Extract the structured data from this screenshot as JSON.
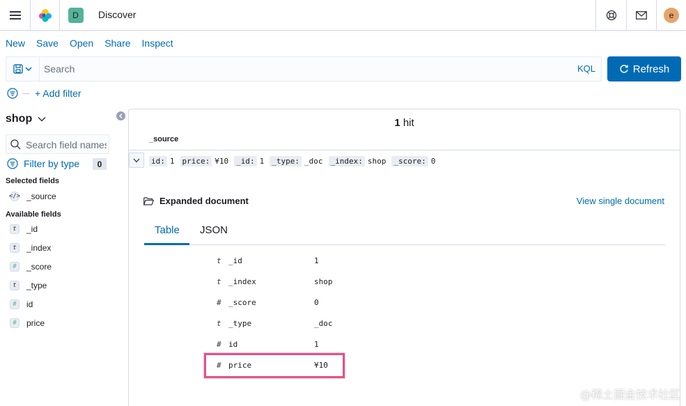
{
  "header": {
    "space_initial": "D",
    "app_title": "Discover",
    "user_initial": "e"
  },
  "topnav": {
    "items": [
      "New",
      "Save",
      "Open",
      "Share",
      "Inspect"
    ]
  },
  "querybar": {
    "placeholder": "Search",
    "language": "KQL",
    "refresh_label": "Refresh"
  },
  "filters": {
    "add_label": "+ Add filter"
  },
  "sidebar": {
    "index_pattern": "shop",
    "search_placeholder": "Search field names",
    "filter_by_type": "Filter by type",
    "filter_count": "0",
    "selected_title": "Selected fields",
    "selected_fields": [
      {
        "name": "_source",
        "type": "source"
      }
    ],
    "available_title": "Available fields",
    "available_fields": [
      {
        "name": "_id",
        "type": "t"
      },
      {
        "name": "_index",
        "type": "t"
      },
      {
        "name": "_score",
        "type": "#"
      },
      {
        "name": "_type",
        "type": "t"
      },
      {
        "name": "id",
        "type": "#"
      },
      {
        "name": "price",
        "type": "#"
      }
    ]
  },
  "results": {
    "hit_count": "1",
    "hit_label": "hit",
    "column_header": "_source",
    "summary": [
      {
        "key": "id:",
        "value": "1"
      },
      {
        "key": "price:",
        "value": "¥10"
      },
      {
        "key": "_id:",
        "value": "1"
      },
      {
        "key": "_type:",
        "value": "_doc"
      },
      {
        "key": "_index:",
        "value": "shop"
      },
      {
        "key": "_score:",
        "value": "0"
      }
    ],
    "expanded_title": "Expanded document",
    "view_single": "View single document",
    "tabs": [
      "Table",
      "JSON"
    ],
    "doc_fields": [
      {
        "type": "t",
        "name": "_id",
        "value": "1"
      },
      {
        "type": "t",
        "name": "_index",
        "value": "shop"
      },
      {
        "type": "#",
        "name": "_score",
        "value": "0"
      },
      {
        "type": "t",
        "name": "_type",
        "value": "_doc"
      },
      {
        "type": "#",
        "name": "id",
        "value": "1"
      },
      {
        "type": "#",
        "name": "price",
        "value": "¥10"
      }
    ]
  },
  "watermark": "@稀土掘金技术社区",
  "colors": {
    "accent": "#006bb4",
    "highlight": "#e0538a",
    "space_avatar": "#54b399",
    "user_avatar": "#e7a36a"
  }
}
